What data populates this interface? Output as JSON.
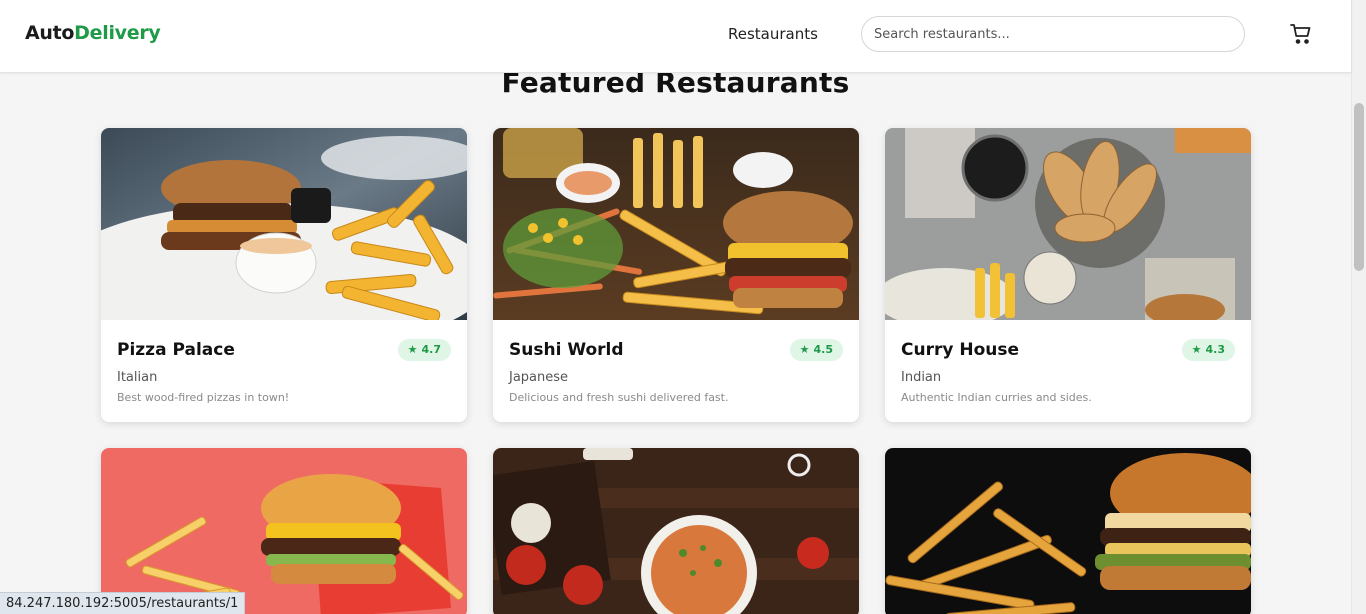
{
  "header": {
    "logo_part1": "Auto",
    "logo_part2": "Delivery",
    "nav_restaurants": "Restaurants",
    "search_placeholder": "Search restaurants...",
    "cart_icon": "cart-icon"
  },
  "main": {
    "title": "Featured Restaurants"
  },
  "restaurants": [
    {
      "name": "Pizza Palace",
      "cuisine": "Italian",
      "description": "Best wood-fired pizzas in town!",
      "rating": "4.7"
    },
    {
      "name": "Sushi World",
      "cuisine": "Japanese",
      "description": "Delicious and fresh sushi delivered fast.",
      "rating": "4.5"
    },
    {
      "name": "Curry House",
      "cuisine": "Indian",
      "description": "Authentic Indian curries and sides.",
      "rating": "4.3"
    }
  ],
  "status_bar": {
    "url": "84.247.180.192:5005/restaurants/1"
  },
  "colors": {
    "brand_green": "#1f9a48",
    "rating_bg": "#dff5e6"
  }
}
